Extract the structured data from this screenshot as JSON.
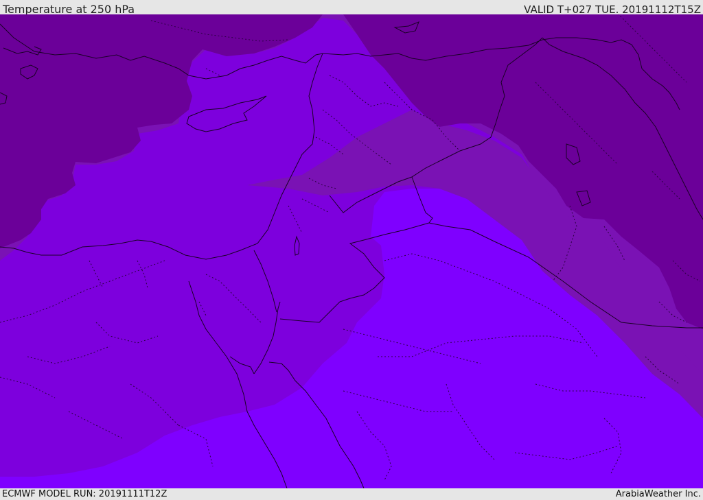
{
  "header": {
    "title": "Temperature at 250 hPa",
    "valid_time": "VALID T+027 TUE. 20191112T15Z"
  },
  "footer": {
    "model_run": "ECMWF MODEL RUN: 20191111T12Z",
    "credit": "ArabiaWeather Inc."
  },
  "map": {
    "field": "Temperature at 250 hPa",
    "colors": {
      "band_coldest": "#6b0099",
      "band_cold": "#7a12b4",
      "band_mid": "#7d00dd",
      "band_warm": "#7f00ff",
      "coastline": "#1a0026"
    }
  }
}
